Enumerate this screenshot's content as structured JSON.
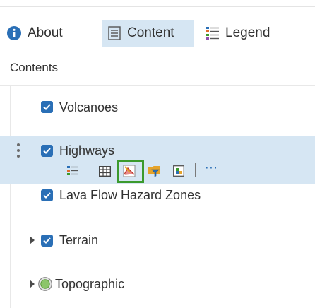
{
  "tabs": [
    {
      "label": "About",
      "icon": "info-icon",
      "active": false
    },
    {
      "label": "Content",
      "icon": "content-list-icon",
      "active": true
    },
    {
      "label": "Legend",
      "icon": "legend-icon",
      "active": false
    }
  ],
  "contents_header": "Contents",
  "layers": [
    {
      "label": "Volcanoes",
      "checked": true
    },
    {
      "label": "Highways",
      "checked": true,
      "selected": true
    },
    {
      "label": "Lava Flow Hazard Zones",
      "checked": true
    },
    {
      "label": "Terrain",
      "checked": true,
      "expandable": true
    },
    {
      "label": "Topographic",
      "expandable": true,
      "icon": "basemap-globe-icon"
    }
  ],
  "layer_tools": {
    "more": "···",
    "icons": [
      "show-legend-icon",
      "attribute-table-icon",
      "change-style-icon",
      "filter-icon",
      "perform-analysis-icon"
    ]
  },
  "colors": {
    "accent": "#2a6fb6",
    "selected_bg": "#d6e6f3",
    "highlight_border": "#3b9a2d",
    "text": "#323232"
  }
}
